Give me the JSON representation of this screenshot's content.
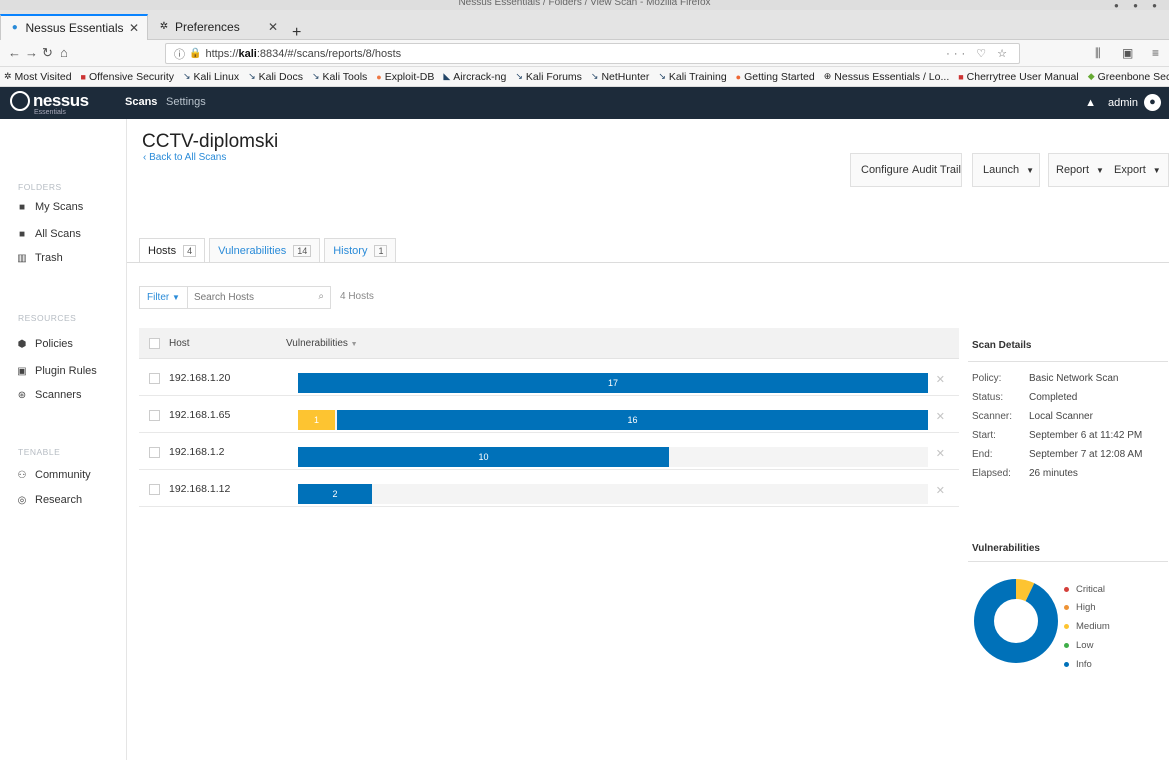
{
  "window": {
    "title": "Nessus Essentials / Folders / View Scan - Mozilla Firefox"
  },
  "tabs": [
    {
      "label": "Nessus Essentials / Fold",
      "active": true
    },
    {
      "label": "Preferences",
      "active": false
    }
  ],
  "nav": {
    "url_prefix": "https://",
    "url_host": "kali",
    "url_rest": ":8834/#/scans/reports/8/hosts"
  },
  "bookmarks": [
    "Most Visited",
    "Offensive Security",
    "Kali Linux",
    "Kali Docs",
    "Kali Tools",
    "Exploit-DB",
    "Aircrack-ng",
    "Kali Forums",
    "NetHunter",
    "Kali Training",
    "Getting Started",
    "Nessus Essentials / Lo...",
    "Cherrytree User Manual",
    "Greenbone Security As..."
  ],
  "header": {
    "logo": "nessus",
    "logo_sub": "Essentials",
    "nav_scans": "Scans",
    "nav_settings": "Settings",
    "user": "admin"
  },
  "sidebar": {
    "folders_label": "FOLDERS",
    "my_scans": "My Scans",
    "all_scans": "All Scans",
    "trash": "Trash",
    "resources_label": "RESOURCES",
    "policies": "Policies",
    "plugin_rules": "Plugin Rules",
    "scanners": "Scanners",
    "tenable_label": "TENABLE",
    "community": "Community",
    "research": "Research"
  },
  "scan": {
    "title": "CCTV-diplomski",
    "back": "‹ Back to All Scans"
  },
  "toolbar": {
    "configure": "Configure",
    "audit_trail": "Audit Trail",
    "launch": "Launch",
    "report": "Report",
    "export": "Export"
  },
  "subtabs": {
    "hosts": "Hosts",
    "hosts_count": "4",
    "vulns": "Vulnerabilities",
    "vulns_count": "14",
    "history": "History",
    "history_count": "1"
  },
  "filter": {
    "label": "Filter",
    "placeholder": "Search Hosts",
    "count": "4 Hosts"
  },
  "table": {
    "col_host": "Host",
    "col_vulns": "Vulnerabilities",
    "rows": [
      {
        "host": "192.168.1.20",
        "medium": 0,
        "medium_label": "",
        "info": 17,
        "info_label": "17"
      },
      {
        "host": "192.168.1.65",
        "medium": 1,
        "medium_label": "1",
        "info": 16,
        "info_label": "16"
      },
      {
        "host": "192.168.1.2",
        "medium": 0,
        "medium_label": "",
        "info": 10,
        "info_label": "10"
      },
      {
        "host": "192.168.1.12",
        "medium": 0,
        "medium_label": "",
        "info": 2,
        "info_label": "2"
      }
    ],
    "scale_max": 17
  },
  "details": {
    "heading": "Scan Details",
    "policy_label": "Policy:",
    "policy": "Basic Network Scan",
    "status_label": "Status:",
    "status": "Completed",
    "scanner_label": "Scanner:",
    "scanner": "Local Scanner",
    "start_label": "Start:",
    "start": "September 6 at 11:42 PM",
    "end_label": "End:",
    "end": "September 7 at 12:08 AM",
    "elapsed_label": "Elapsed:",
    "elapsed": "26 minutes"
  },
  "vuln_panel": {
    "heading": "Vulnerabilities",
    "legend": [
      {
        "label": "Critical",
        "color": "#d43f3a"
      },
      {
        "label": "High",
        "color": "#ee9336"
      },
      {
        "label": "Medium",
        "color": "#fdc431"
      },
      {
        "label": "Low",
        "color": "#3fae49"
      },
      {
        "label": "Info",
        "color": "#0071b9"
      }
    ],
    "donut": {
      "medium": 1,
      "info": 13
    }
  },
  "colors": {
    "info": "#0071b9",
    "medium": "#fdc431",
    "header": "#1d2b3a",
    "link": "#2a8bd8"
  }
}
